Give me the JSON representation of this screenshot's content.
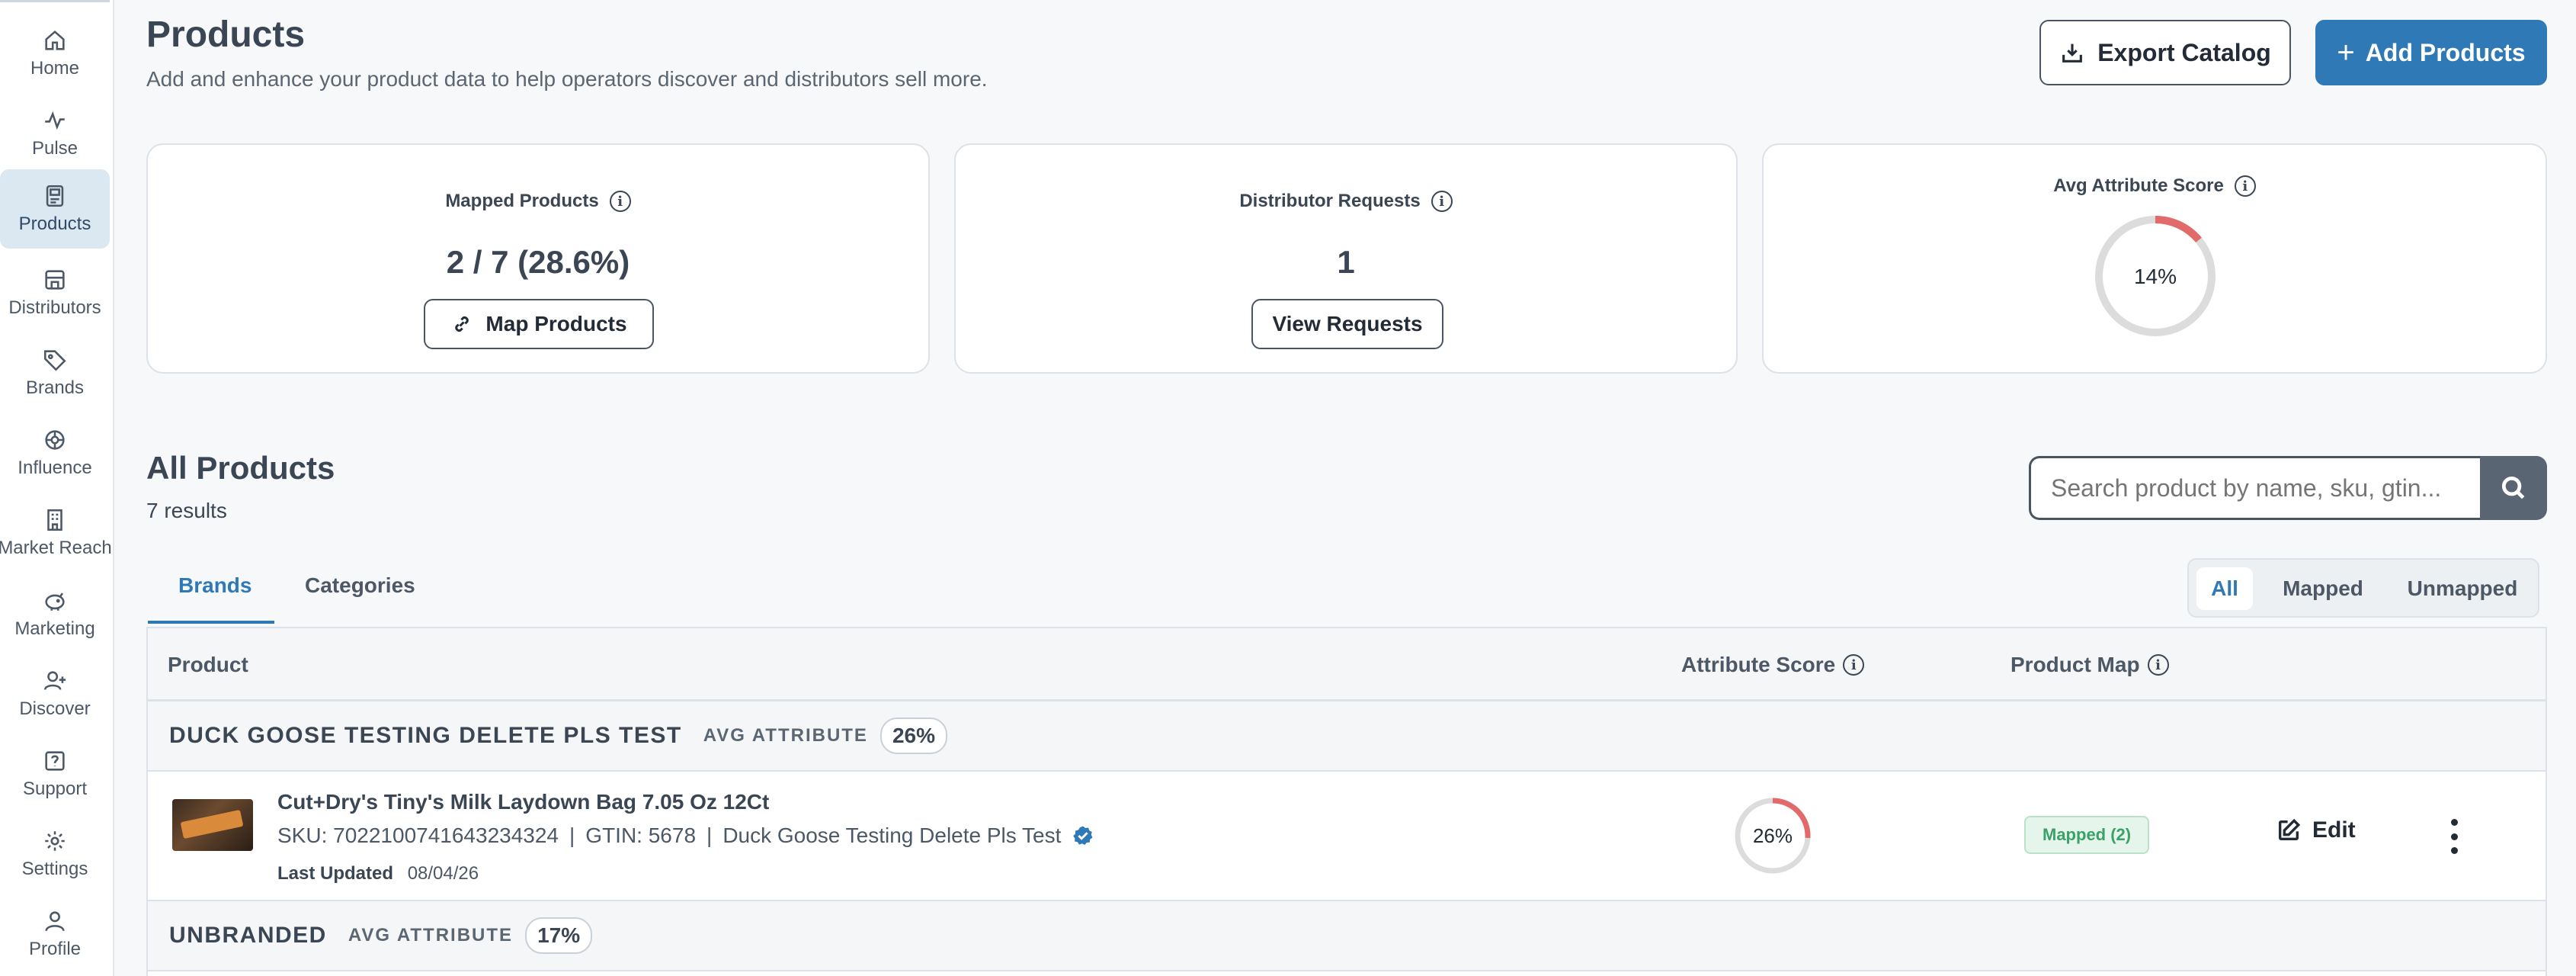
{
  "sidebar": {
    "items": [
      {
        "label": "Home",
        "icon": "home-icon"
      },
      {
        "label": "Pulse",
        "icon": "pulse-icon"
      },
      {
        "label": "Products",
        "icon": "products-icon",
        "active": true
      },
      {
        "label": "Distributors",
        "icon": "distributors-icon"
      },
      {
        "label": "Brands",
        "icon": "tag-icon"
      },
      {
        "label": "Influence",
        "icon": "influence-icon"
      },
      {
        "label": "Market Reach",
        "icon": "building-icon"
      },
      {
        "label": "Marketing",
        "icon": "piggy-bank-icon"
      },
      {
        "label": "Discover",
        "icon": "user-plus-icon"
      },
      {
        "label": "Support",
        "icon": "help-icon"
      },
      {
        "label": "Settings",
        "icon": "gear-icon"
      },
      {
        "label": "Profile",
        "icon": "user-icon"
      }
    ]
  },
  "header": {
    "title": "Products",
    "subtitle": "Add and enhance your product data to help operators discover and distributors sell more.",
    "export_label": "Export Catalog",
    "add_label": "Add Products"
  },
  "stats": {
    "mapped": {
      "title": "Mapped Products",
      "value": "2 / 7 (28.6%)",
      "button": "Map Products"
    },
    "requests": {
      "title": "Distributor Requests",
      "value": "1",
      "button": "View Requests"
    },
    "score": {
      "title": "Avg Attribute Score",
      "value": "14%",
      "percent": 14
    }
  },
  "list": {
    "title": "All Products",
    "count": "7 results",
    "search_placeholder": "Search product by name, sku, gtin...",
    "tabs": [
      "Brands",
      "Categories"
    ],
    "filters": [
      "All",
      "Mapped",
      "Unmapped"
    ],
    "columns": {
      "product": "Product",
      "score": "Attribute Score",
      "map": "Product Map"
    }
  },
  "groups": [
    {
      "name": "DUCK GOOSE TESTING DELETE PLS TEST",
      "avg_label": "AVG ATTRIBUTE",
      "avg_value": "26%",
      "products": [
        {
          "name": "Cut+Dry's Tiny's Milk Laydown Bag 7.05 Oz 12Ct",
          "sku": "SKU: 7022100741643234324",
          "sep1": "|",
          "gtin": "GTIN: 5678",
          "sep2": "|",
          "brand": "Duck Goose Testing Delete Pls Test",
          "updated_label": "Last Updated",
          "updated_value": "08/04/26",
          "score": "26%",
          "score_percent": 26,
          "map_badge": "Mapped (2)",
          "edit_label": "Edit"
        }
      ]
    },
    {
      "name": "UNBRANDED",
      "avg_label": "AVG ATTRIBUTE",
      "avg_value": "17%"
    }
  ],
  "colors": {
    "accent": "#2e79b6",
    "score_arc": "#e26a6a",
    "ring": "#dcdcdc",
    "mapped_green": "#3aa167"
  }
}
